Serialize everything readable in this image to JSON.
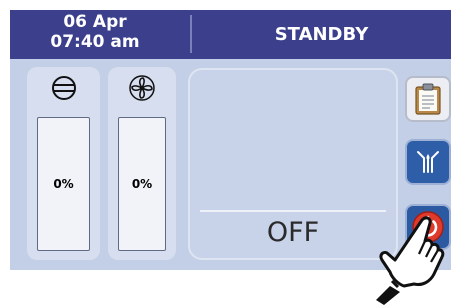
{
  "header": {
    "date": "06 Apr",
    "time": "07:40 am",
    "status": "STANDBY"
  },
  "compressor": {
    "icon": "compressor-icon",
    "level_label": "0%",
    "level_fraction": 0.0
  },
  "fan": {
    "icon": "fan-icon",
    "level_label": "0%",
    "level_fraction": 0.0
  },
  "main_display": {
    "state_text": "OFF"
  },
  "side_buttons": [
    {
      "icon": "clipboard-icon"
    },
    {
      "icon": "defrost-icon"
    },
    {
      "icon": "power-icon"
    }
  ],
  "overlay": {
    "icon": "pointing-hand-icon"
  },
  "colors": {
    "header_bg": "#3b3f8c",
    "screen_bg": "#c3cfe6",
    "button_blue": "#2f5ea8",
    "power_red": "#e03a2c"
  }
}
